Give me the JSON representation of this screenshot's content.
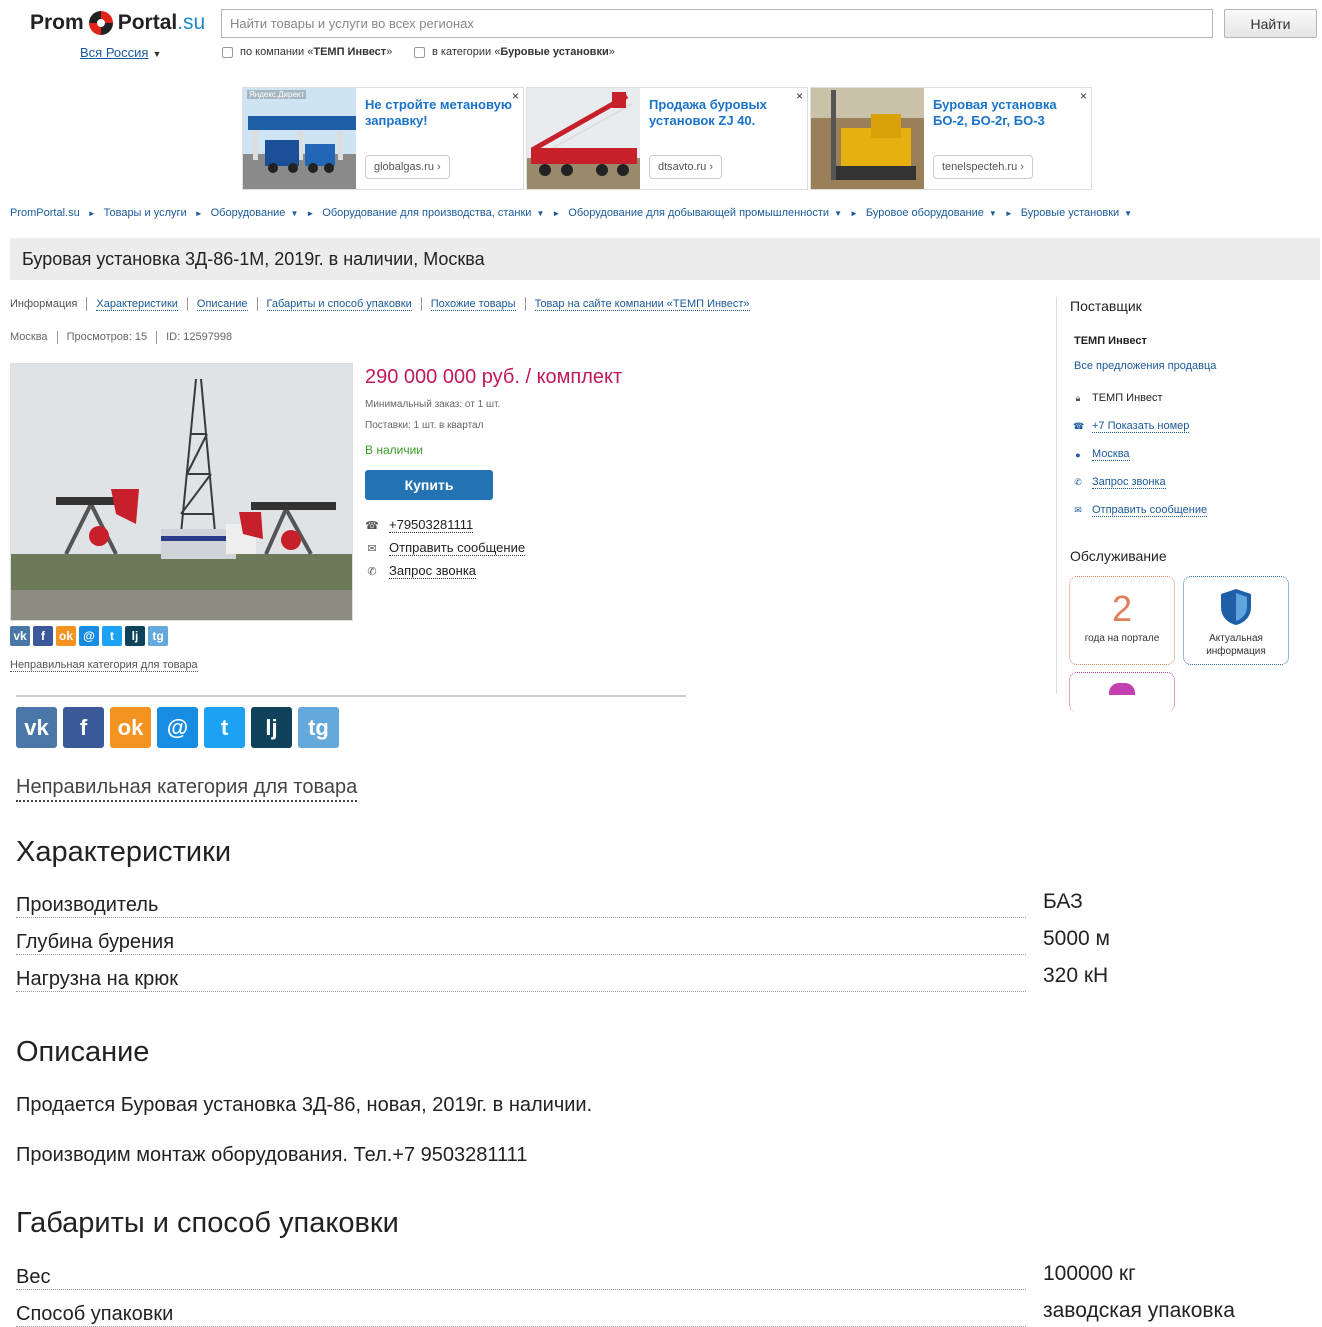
{
  "header": {
    "logo_left": "Prom",
    "logo_right": "Portal",
    "logo_su": ".su",
    "region": "Вся Россия",
    "search_placeholder": "Найти товары и услуги во всех регионах",
    "search_button": "Найти",
    "filter_company_prefix": "по компании «",
    "filter_company": "ТЕМП Инвест",
    "filter_company_suffix": "»",
    "filter_category_prefix": "в категории «",
    "filter_category": "Буровые установки",
    "filter_category_suffix": "»"
  },
  "ads": [
    {
      "title": "Не стройте метановую заправку!",
      "domain": "globalgas.ru ›",
      "tag": "Яндекс.Директ"
    },
    {
      "title": "Продажа буровых установок ZJ 40.",
      "domain": "dtsavto.ru ›"
    },
    {
      "title": "Буровая установка БО-2, БО-2г, БО-3",
      "domain": "tenelspecteh.ru ›"
    }
  ],
  "ad_close": "×",
  "breadcrumb": [
    "PromPortal.su",
    "Товары и услуги",
    "Оборудование",
    "Оборудование для производства, станки",
    "Оборудование для добывающей промышленности",
    "Буровое оборудование",
    "Буровые установки"
  ],
  "title": "Буровая установка 3Д-86-1М, 2019г. в наличии, Москва",
  "tabs": [
    "Информация",
    "Характеристики",
    "Описание",
    "Габариты и способ упаковки",
    "Похожие товары",
    "Товар на сайте компании «ТЕМП Инвест»"
  ],
  "meta": {
    "city": "Москва",
    "views": "Просмотров: 15",
    "id": "ID: 12597998"
  },
  "product": {
    "price": "290 000 000 руб. / комплект",
    "min_order": "Минимальный заказ: от 1 шт.",
    "supply": "Поставки: 1 шт. в квартал",
    "availability": "В наличии",
    "buy_label": "Купить",
    "phone": "+79503281111",
    "send_message": "Отправить сообщение",
    "call_request": "Запрос звонка",
    "wrong_category": "Неправильная категория для товара"
  },
  "share": [
    {
      "icon": "vk-icon",
      "glyph": "vk",
      "color": "#4a76a8"
    },
    {
      "icon": "facebook-icon",
      "glyph": "f",
      "color": "#3b5998"
    },
    {
      "icon": "odnoklassniki-icon",
      "glyph": "ok",
      "color": "#f59320"
    },
    {
      "icon": "moimir-icon",
      "glyph": "@",
      "color": "#168de2"
    },
    {
      "icon": "twitter-icon",
      "glyph": "t",
      "color": "#1da1f2"
    },
    {
      "icon": "livejournal-icon",
      "glyph": "lj",
      "color": "#0d425a"
    },
    {
      "icon": "telegram-icon",
      "glyph": "tg",
      "color": "#64a9dc"
    }
  ],
  "sidebar": {
    "supplier_heading": "Поставщик",
    "supplier_name": "ТЕМП Инвест",
    "all_offers": "Все предложения продавца",
    "company": "ТЕМП Инвест",
    "show_phone": "+7 Показать номер",
    "city": "Москва",
    "call_request": "Запрос звонка",
    "send_message": "Отправить сообщение",
    "service_heading": "Обслуживание",
    "badge_years_num": "2",
    "badge_years_label": "года на портале",
    "badge_actual_label": "Актуальная информация"
  },
  "specs_heading": "Характеристики",
  "specs": [
    {
      "key": "Производитель",
      "value": "БАЗ"
    },
    {
      "key": "Глубина бурения",
      "value": "5000 м"
    },
    {
      "key": "Нагрузна на крюк",
      "value": "320 кН"
    }
  ],
  "description_heading": "Описание",
  "description": [
    "Продается Буровая установка 3Д-86, новая, 2019г. в наличии.",
    "Производим монтаж оборудования. Тел.+7 9503281111"
  ],
  "packaging_heading": "Габариты и способ упаковки",
  "packaging": [
    {
      "key": "Вес",
      "value": "100000 кг"
    },
    {
      "key": "Способ упаковки",
      "value": "заводская упаковка"
    }
  ]
}
